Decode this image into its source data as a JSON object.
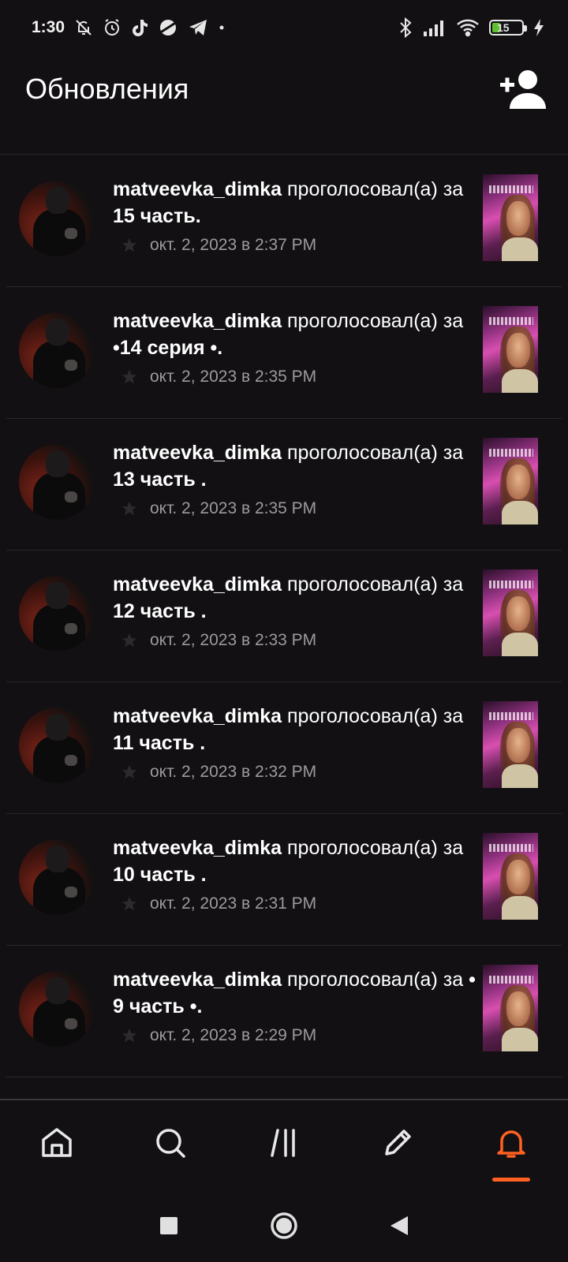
{
  "status_bar": {
    "time": "1:30",
    "left_icons": [
      "bell-off-icon",
      "alarm-icon",
      "tiktok-icon",
      "planet-icon",
      "telegram-icon",
      "dot-icon"
    ],
    "right_icons": [
      "bluetooth-icon",
      "signal-icon",
      "wifi-icon",
      "battery-icon",
      "charging-icon"
    ],
    "battery_level": "15"
  },
  "header": {
    "title": "Обновления",
    "action_icon": "add-user-icon"
  },
  "notifications": [
    {
      "user": "matveevka_dimka",
      "action": "проголосовал(а)",
      "prefix": "за",
      "part": "15 часть.",
      "time": "окт. 2, 2023 в 2:37 PM"
    },
    {
      "user": "matveevka_dimka",
      "action": "проголосовал(а)",
      "prefix": "за",
      "part": "•14 серия •.",
      "time": "окт. 2, 2023 в 2:35 PM"
    },
    {
      "user": "matveevka_dimka",
      "action": "проголосовал(а)",
      "prefix": "за",
      "part": "13 часть .",
      "time": "окт. 2, 2023 в 2:35 PM"
    },
    {
      "user": "matveevka_dimka",
      "action": "проголосовал(а)",
      "prefix": "за",
      "part": "12 часть .",
      "time": "окт. 2, 2023 в 2:33 PM"
    },
    {
      "user": "matveevka_dimka",
      "action": "проголосовал(а)",
      "prefix": "за",
      "part": "11 часть .",
      "time": "окт. 2, 2023 в 2:32 PM"
    },
    {
      "user": "matveevka_dimka",
      "action": "проголосовал(а)",
      "prefix": "за",
      "part": "10 часть .",
      "time": "окт. 2, 2023 в 2:31 PM"
    },
    {
      "user": "matveevka_dimka",
      "action": "проголосовал(а)",
      "prefix": "за",
      "part": "• 9 часть •.",
      "time": "окт. 2, 2023 в 2:29 PM"
    }
  ],
  "bottom_nav": {
    "items": [
      "home-icon",
      "search-icon",
      "library-icon",
      "write-icon",
      "notifications-icon"
    ],
    "active": "notifications-icon",
    "accent_color": "#ff6122",
    "icon_color": "#e8e8e8"
  },
  "system_nav": [
    "recents-button",
    "home-button",
    "back-button"
  ]
}
